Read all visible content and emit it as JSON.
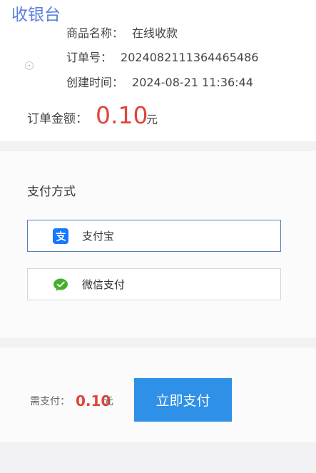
{
  "header": {
    "title": "收银台"
  },
  "order": {
    "product_label": "商品名称：",
    "product_value": "在线收款",
    "order_no_label": "订单号：",
    "order_no_value": "2024082111364465486",
    "created_label": "创建时间：",
    "created_value": "2024-08-21 11:36:44",
    "amount_label": "订单金额：",
    "amount_value": "0.10",
    "amount_unit": "元"
  },
  "payment_methods": {
    "title": "支付方式",
    "options": [
      {
        "label": "支付宝",
        "icon": "alipay-icon",
        "selected": true
      },
      {
        "label": "微信支付",
        "icon": "wechat-icon",
        "selected": false
      }
    ]
  },
  "pay_bar": {
    "due_label": "需支付：",
    "due_amount": "0.10",
    "due_unit": "元",
    "pay_button_label": "立即支付"
  },
  "colors": {
    "title_blue": "#5b7fe0",
    "amount_red": "#e0453a",
    "button_blue": "#2e90e6",
    "selected_border": "#5a7fb8",
    "alipay_blue": "#1677ff",
    "wechat_green": "#43b02a"
  }
}
